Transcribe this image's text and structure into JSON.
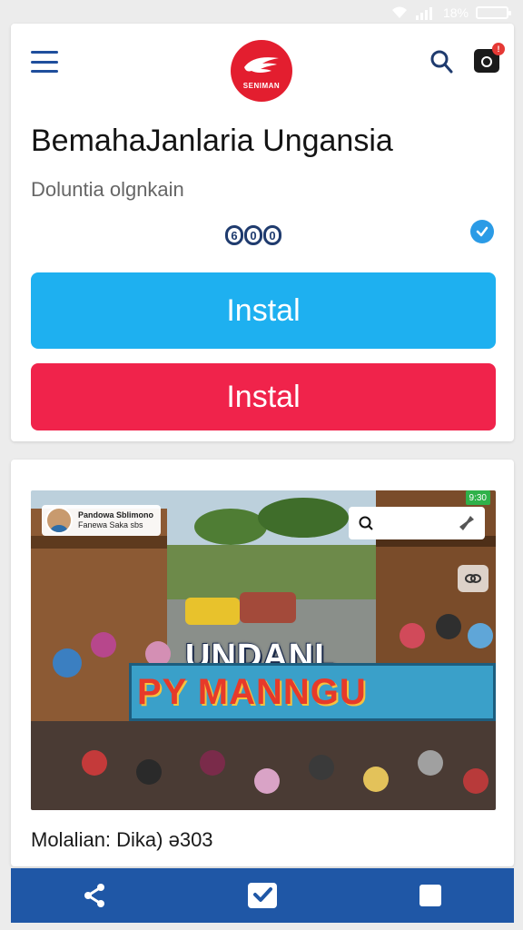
{
  "status_bar": {
    "battery_label": "18%",
    "battery_level": 0.18,
    "icons": [
      "wifi-icon",
      "signal-icon",
      "battery-icon"
    ]
  },
  "header": {
    "logo_text": "SENIMAN",
    "icons": [
      "menu-icon",
      "search-icon",
      "camera-icon"
    ],
    "notification_count": "!"
  },
  "app": {
    "title": "BemahaJanlaria Ungansia",
    "subtitle": "Doluntia olgnkain",
    "rating_badge": [
      "6",
      "0",
      "0"
    ],
    "primary_button": "Instal",
    "secondary_button": "Instal"
  },
  "media": {
    "channel_name": "Pandowa Sblimono",
    "channel_sub": "Fanewa Saka sbs",
    "top_badge": "9:30",
    "headline": "UNDANL",
    "banner": "PY MANNGU",
    "caption": "Molalian: Dika) ə303"
  },
  "bottom_nav": {
    "items": [
      "share-icon",
      "check-icon",
      "stop-icon"
    ]
  },
  "colors": {
    "accent_blue": "#1eb0f0",
    "accent_red": "#f0234b",
    "nav_blue": "#1f57a6",
    "logo_red": "#e31e2f"
  }
}
